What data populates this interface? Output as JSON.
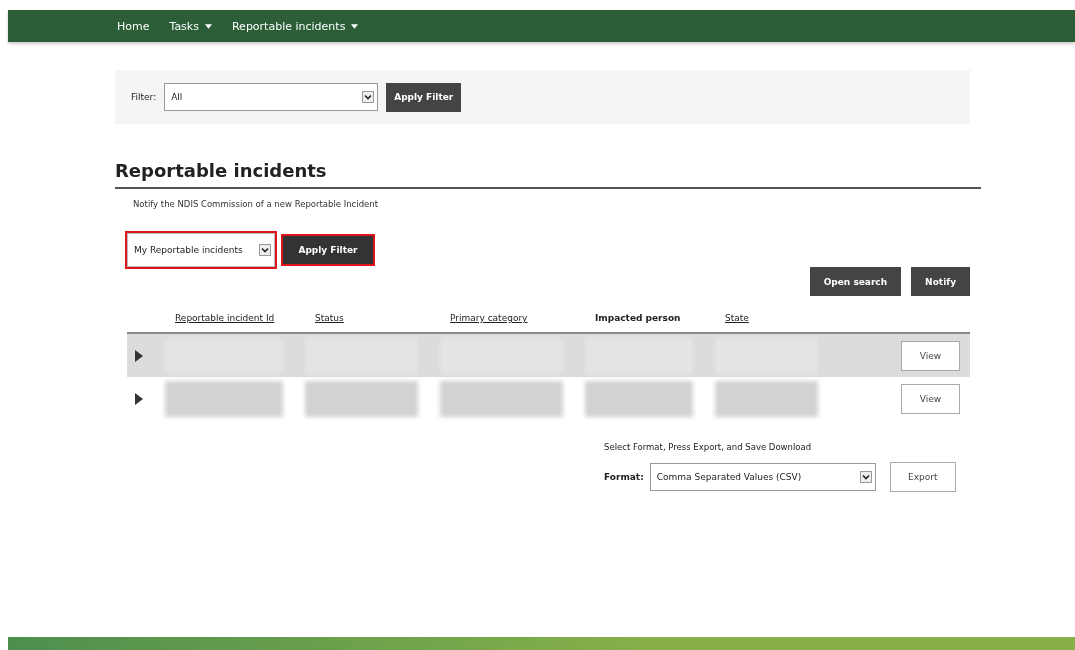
{
  "nav": {
    "items": [
      {
        "label": "Home",
        "dropdown": false
      },
      {
        "label": "Tasks",
        "dropdown": true
      },
      {
        "label": "Reportable incidents",
        "dropdown": true
      }
    ]
  },
  "filter_panel": {
    "label": "Filter:",
    "select": {
      "value": "All"
    },
    "button": "Apply Filter"
  },
  "heading": "Reportable incidents",
  "intro": "Notify the NDIS Commission of a new Reportable Incident",
  "list_filter": {
    "select": {
      "value": "My Reportable incidents",
      "annotated": true
    },
    "button": {
      "label": "Apply Filter",
      "annotated": true
    }
  },
  "actions": [
    "Open search",
    "Notify"
  ],
  "table": {
    "columns": [
      {
        "label": "Reportable incident Id",
        "sortable": true
      },
      {
        "label": "Status",
        "sortable": true
      },
      {
        "label": "Primary category",
        "sortable": true
      },
      {
        "label": "Impacted person",
        "sortable": false
      },
      {
        "label": "State",
        "sortable": true
      }
    ],
    "rows": [
      {
        "selected": true,
        "action": "View"
      },
      {
        "selected": false,
        "action": "View"
      }
    ]
  },
  "export": {
    "instruction": "Select Format, Press Export, and Save Download",
    "label": "Format:",
    "select": {
      "value": "Comma Separated Values (CSV)"
    },
    "button": "Export"
  }
}
